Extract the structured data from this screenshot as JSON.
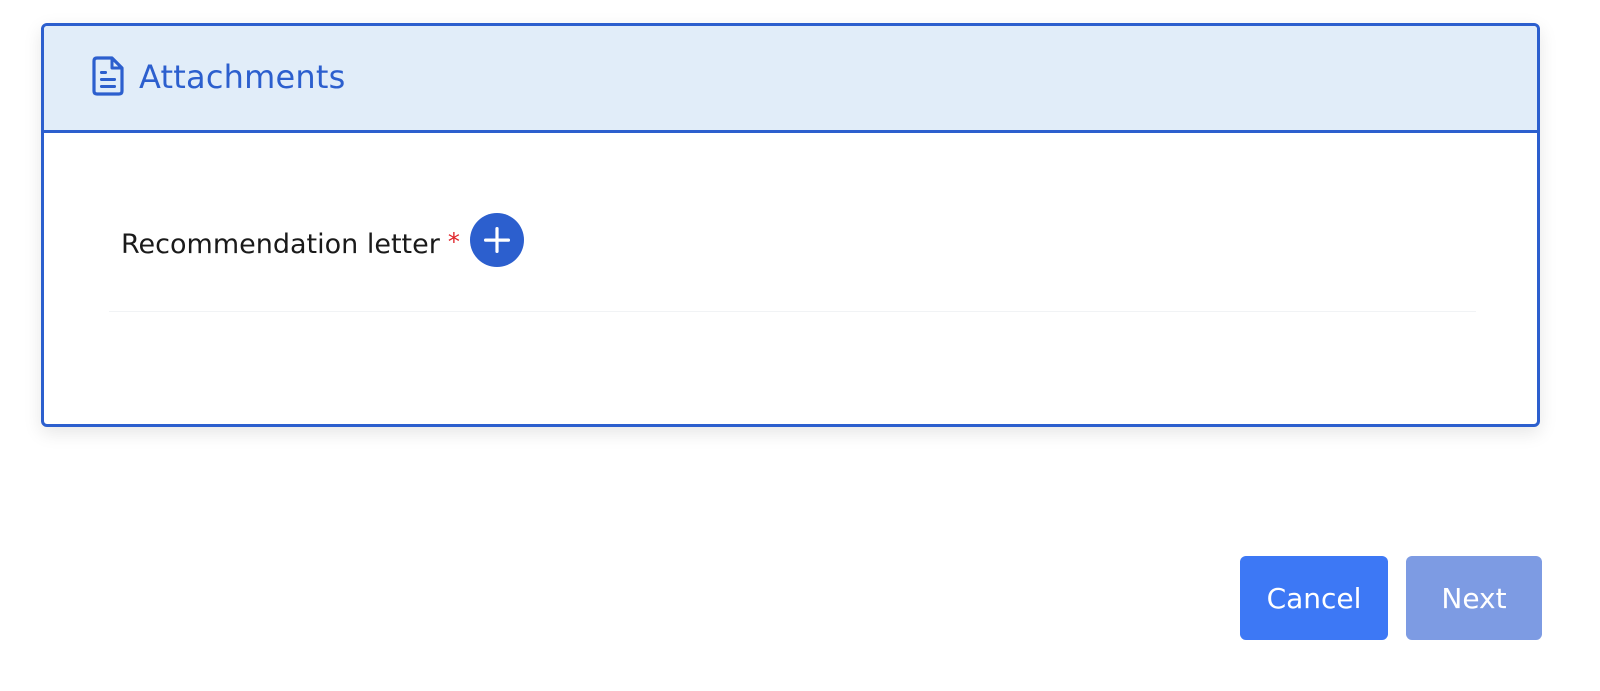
{
  "section": {
    "icon": "document-icon",
    "title": "Attachments"
  },
  "fields": [
    {
      "label": "Recommendation letter",
      "required_mark": "*",
      "add_icon": "plus-icon"
    }
  ],
  "actions": {
    "cancel_label": "Cancel",
    "next_label": "Next"
  },
  "colors": {
    "accent": "#2c5fce",
    "header_bg": "#e1edf9",
    "required": "#e0242a",
    "cancel_bg": "#3d78f5",
    "next_disabled_bg": "#7d9be3"
  }
}
